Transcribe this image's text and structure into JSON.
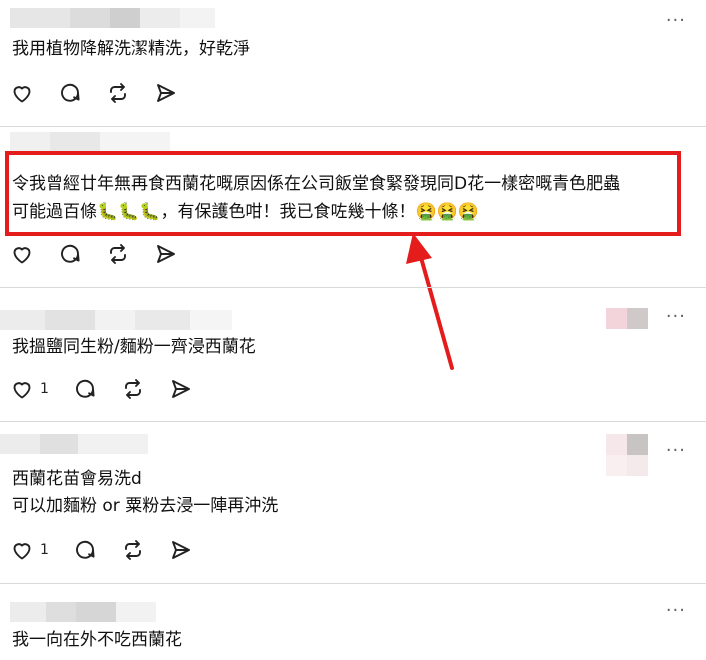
{
  "comments": [
    {
      "text_lines": [
        "我用植物降解洗潔精洗，好乾淨"
      ],
      "likes": ""
    },
    {
      "text_lines": [
        "令我曾經廿年無再食西蘭花嘅原因係在公司飯堂食緊發現同D花一樣密嘅青色肥蟲",
        "可能過百條🐛🐛🐛，有保護色咁！我已食咗幾十條！🤮🤮🤮"
      ],
      "likes": ""
    },
    {
      "text_lines": [
        "我搵鹽同生粉/麵粉一齊浸西蘭花"
      ],
      "likes": "1"
    },
    {
      "text_lines": [
        "西蘭花苗會易洗d",
        "可以加麵粉 or 粟粉去浸一陣再沖洗"
      ],
      "likes": "1"
    },
    {
      "text_lines": [
        "我一向在外不吃西蘭花"
      ],
      "likes": ""
    }
  ],
  "more_glyph": "···",
  "icons": [
    "heart-icon",
    "comment-icon",
    "repost-icon",
    "share-icon"
  ],
  "colors": {
    "highlight": "#e41c1c",
    "divider": "#d9d9d9"
  }
}
